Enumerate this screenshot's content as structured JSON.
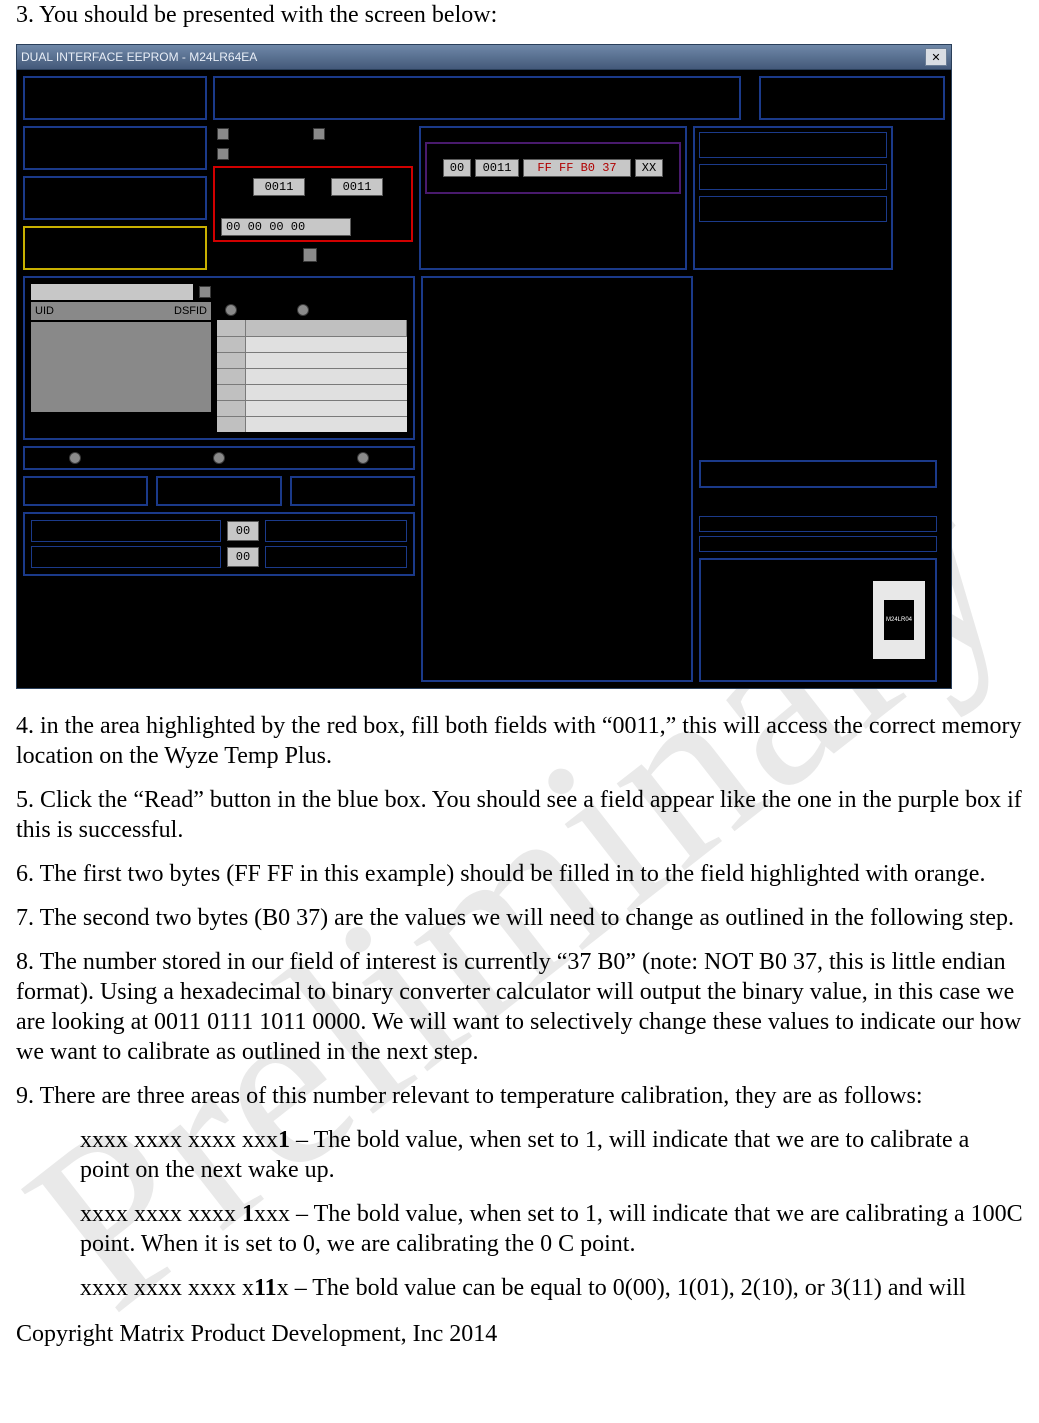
{
  "intro_line": "3. You should be presented with the screen below:",
  "window": {
    "title": "DUAL INTERFACE EEPROM - M24LR64EA",
    "close": "✕",
    "red_in_1": "0011",
    "red_in_2": "0011",
    "red_wide": "00 00 00 00",
    "purple": {
      "f1": "00",
      "f2": "0011",
      "f3": "FF FF B0 37",
      "f4": "XX"
    },
    "uid_label": "UID",
    "dsfid_label": "DSFID",
    "compact_v1": "00",
    "compact_v2": "00",
    "chip_label": "M24LR04"
  },
  "step4": "4. in the area highlighted by the red box, fill both fields with “0011,” this will access the correct memory location on the Wyze Temp Plus.",
  "step5": "5. Click the “Read” button in the blue box. You should see a field appear like the one in the purple box if this is successful.",
  "step6": "6. The first two bytes (FF FF in this example) should be filled in to the field highlighted with orange.",
  "step7": "7. The second two bytes (B0 37) are the values we will need to change as outlined in the following step.",
  "step8": "8. The number stored in our field of interest is currently “37 B0” (note: NOT B0 37, this is little endian format). Using a hexadecimal to binary converter calculator will output the binary value, in this case we are looking at 0011 0111 1011 0000. We will want to selectively change these values to indicate our how we want to calibrate as outlined in the next step.",
  "step9": "9. There are three areas of this number relevant to temperature calibration, they are as follows:",
  "bullets": {
    "a": {
      "pre": "xxxx xxxx xxxx xxx",
      "bold": "1",
      "post": " – The bold value, when set to 1, will indicate that we are to calibrate a point on the next wake up."
    },
    "b": {
      "pre": "xxxx xxxx xxxx ",
      "bold": "1",
      "post": "xxx – The bold value, when set to 1, will indicate that we are calibrating a 100C point. When it is set to 0, we are calibrating the 0 C point."
    },
    "c": {
      "pre": "xxxx xxxx xxxx x",
      "bold": "11",
      "post": "x – The bold value can be equal to 0(00), 1(01), 2(10), or 3(11) and will"
    }
  },
  "copyright": "Copyright Matrix Product Development, Inc 2014"
}
